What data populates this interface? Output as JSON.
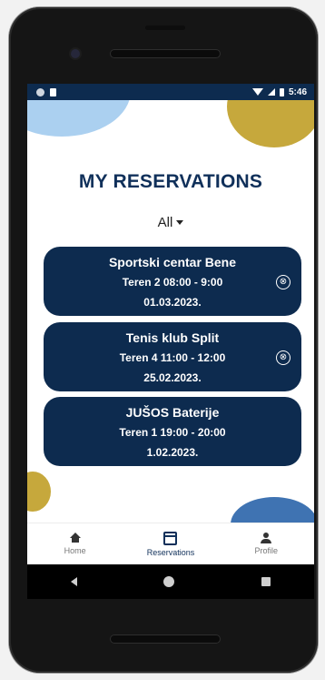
{
  "status_bar": {
    "time": "5:46"
  },
  "page": {
    "title": "MY RESERVATIONS"
  },
  "filter": {
    "selected": "All"
  },
  "reservations": [
    {
      "venue": "Sportski centar Bene",
      "slot": "Teren 2  08:00 - 9:00",
      "date": "01.03.2023.",
      "cancel_icon": "⊗"
    },
    {
      "venue": "Tenis klub Split",
      "slot": "Teren 4 11:00 - 12:00",
      "date": "25.02.2023.",
      "cancel_icon": "⊗"
    },
    {
      "venue": "JUŠOS Baterije",
      "slot": "Teren 1 19:00 - 20:00",
      "date": "1.02.2023."
    }
  ],
  "bottom_nav": [
    {
      "label": "Home",
      "icon": "home-icon"
    },
    {
      "label": "Reservations",
      "icon": "calendar-icon"
    },
    {
      "label": "Profile",
      "icon": "person-icon"
    }
  ],
  "colors": {
    "primary": "#0d2b4f",
    "accent_gold": "#c6a83c",
    "accent_light_blue": "#abd0f0",
    "accent_blue": "#3f73b2"
  }
}
